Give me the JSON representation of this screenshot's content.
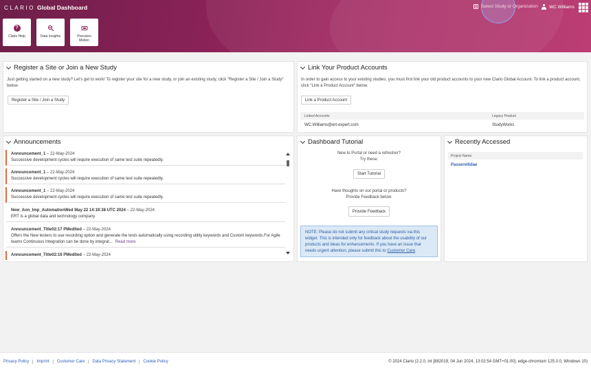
{
  "header": {
    "logo": "CLARIO",
    "title": "Global Dashboard",
    "study_select": "Select Study or Organization",
    "user": "WC Williams"
  },
  "tiles": [
    {
      "label": "Clario Help",
      "icon": "help-icon"
    },
    {
      "label": "Data Insights",
      "icon": "data-insights-icon"
    },
    {
      "label": "Precision Motion",
      "icon": "precision-motion-icon"
    }
  ],
  "register": {
    "title": "Register a Site or Join a New Study",
    "text": "Just getting started on a new study? Let's get to work! To register your site for a new study, or join an existing study, click \"Register a Site / Join a Study\" below.",
    "button": "Register a Site / Join a Study"
  },
  "link_accounts": {
    "title": "Link Your Product Accounts",
    "text": "In order to gain access to your existing studies, you must first link your old product accounts to your new Clario Global Account. To link a product account, click \"Link a Product Account\" below.",
    "button": "Link a Product Account",
    "columns": [
      "Linked Accounts",
      "Legacy Product"
    ],
    "rows": [
      [
        "WC.Williams@ert-expert.com",
        "StudyWorks"
      ]
    ]
  },
  "announcements": {
    "title": "Announcements",
    "items": [
      {
        "title": "Announcement_1",
        "date": "22-May-2024",
        "body": "Successive development cycles will require execution of same test suite repeatedly.",
        "more": ""
      },
      {
        "title": "Announcement_1",
        "date": "22-May-2024",
        "body": "Successive development cycles will require execution of same test suite repeatedly.",
        "more": ""
      },
      {
        "title": "Announcement_1",
        "date": "22-May-2024",
        "body": "Successive development cycles will require execution of same test suite repeatedly.",
        "more": ""
      },
      {
        "title": "New_Ann_Imp_AutomationWed May 22 14:19:38 UTC 2024",
        "date": "22-May-2024",
        "body": "ERT is a global data and technology company",
        "more": ""
      },
      {
        "title": "Announcement_Title02:17 PMedited",
        "date": "22-May-2024",
        "body": "Offers the New testers to use recording option and generate the tests automatically using recording utility keywords and Custom keywords.For Agile teams Continuous Integration can be done by integrat...",
        "more": "Read more"
      },
      {
        "title": "Announcement_Title02:16 PMedited",
        "date": "22-May-2024",
        "body": "",
        "more": ""
      }
    ]
  },
  "tutorial": {
    "title": "Dashboard Tutorial",
    "intro_line1": "New to Portal or need a refresher?",
    "intro_line2": "Try these:",
    "start_button": "Start Tutorial",
    "feedback_line1": "Have thoughts on our portal or products?",
    "feedback_line2": "Provide Feedback below:",
    "feedback_button": "Provide Feedback",
    "note": "NOTE: Please do not submit any critical study requests via this widget. This is intended only for feedback about the usability of our products and ideas for enhancements. If you have an issue that needs urgent attention, please submit this to ",
    "note_link": "Customer Care",
    "note_end": "."
  },
  "recent": {
    "title": "Recently Accessed",
    "column": "Project Name",
    "items": [
      "Passerellidae"
    ]
  },
  "footer": {
    "links": [
      "Privacy Policy",
      "Imprint",
      "Customer Care",
      "Data Privacy Statement",
      "Cookie Policy"
    ],
    "info": "© 2024 Clario (2.2.0, int [882019, 04 Jun 2024, 13:02:54 GMT+01:00], edge-chromium 125.0.0, Windows 10)"
  },
  "colors": {
    "brand": "#8a2257",
    "accent_link": "#2b5db8",
    "announcement_bar": "#d86a3a"
  }
}
